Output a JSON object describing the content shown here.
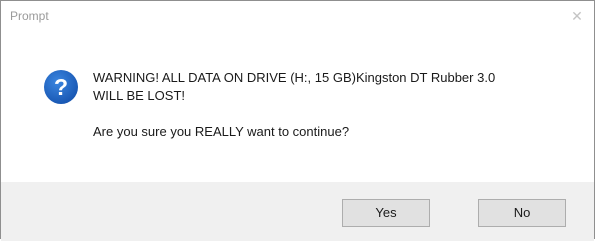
{
  "window": {
    "title": "Prompt",
    "close_glyph": "✕"
  },
  "message": {
    "icon": "question-icon",
    "line1": "WARNING! ALL DATA ON DRIVE (H:, 15 GB)Kingston DT Rubber 3.0",
    "line2": "WILL BE LOST!",
    "line3": "Are you sure you REALLY want to continue?"
  },
  "buttons": {
    "yes_label": "Yes",
    "no_label": "No"
  },
  "colors": {
    "icon_blue": "#1f66c6",
    "footer_bg": "#f0f0f0",
    "button_bg": "#e1e1e1",
    "button_border": "#adadad"
  }
}
